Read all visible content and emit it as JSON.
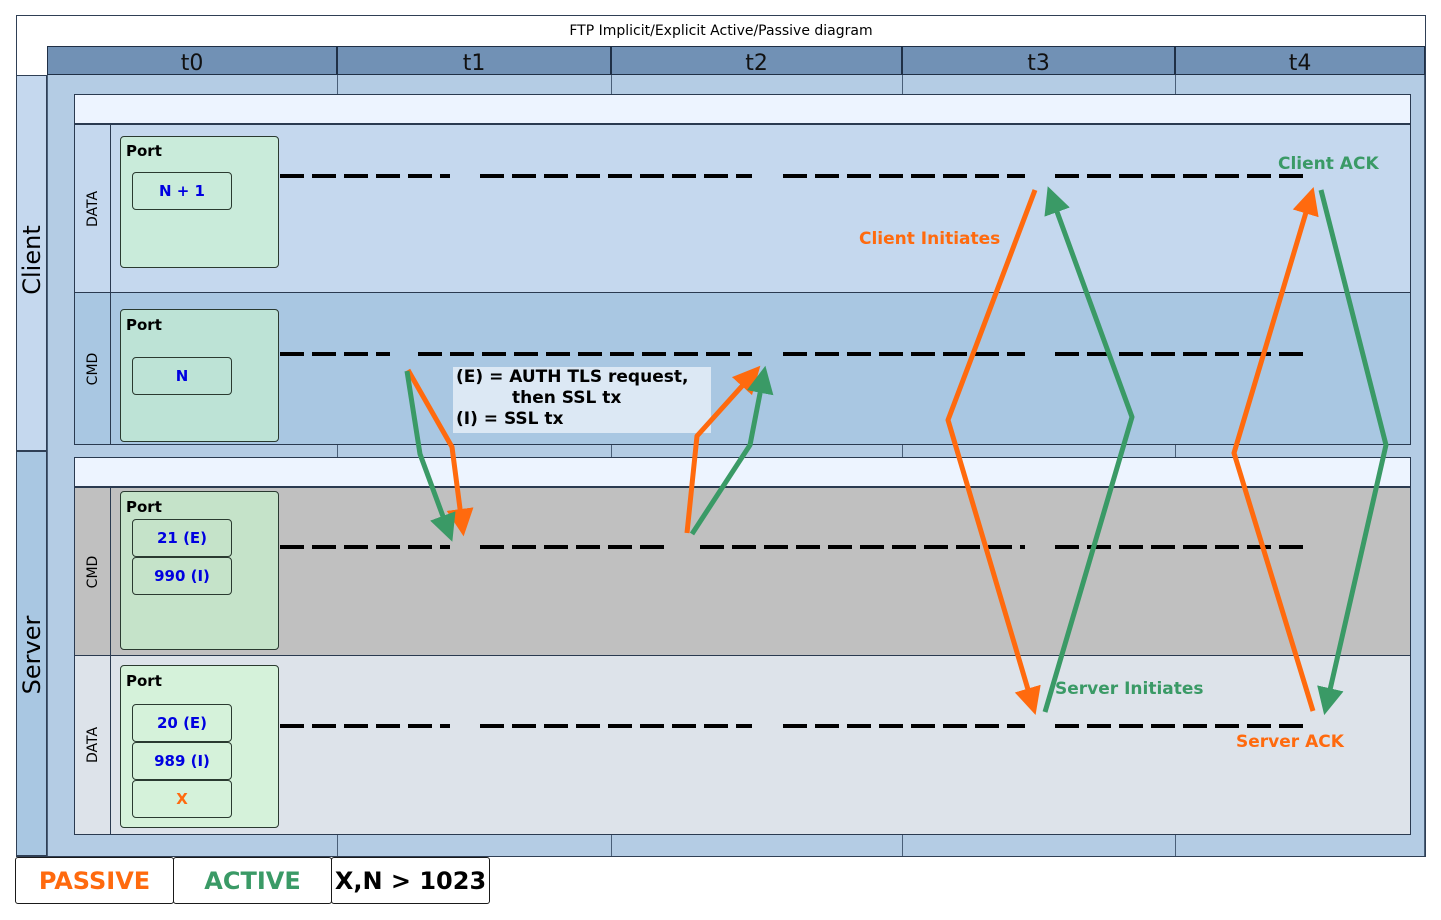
{
  "title": "FTP Implicit/Explicit Active/Passive diagram",
  "time_columns": [
    "t0",
    "t1",
    "t2",
    "t3",
    "t4"
  ],
  "pools": {
    "client": {
      "label": "Client",
      "lanes": {
        "data": {
          "label": "DATA",
          "port_title": "Port",
          "ports": [
            "N + 1"
          ]
        },
        "cmd": {
          "label": "CMD",
          "port_title": "Port",
          "ports": [
            "N"
          ]
        }
      }
    },
    "server": {
      "label": "Server",
      "lanes": {
        "cmd": {
          "label": "CMD",
          "port_title": "Port",
          "ports": [
            "21 (E)",
            "990 (I)"
          ]
        },
        "data": {
          "label": "DATA",
          "port_title": "Port",
          "ports": [
            "20 (E)",
            "989 (I)",
            "X"
          ]
        }
      }
    }
  },
  "note": {
    "line1": "(E) = AUTH TLS request,",
    "line2": "then SSL tx",
    "line3": "(I) = SSL tx"
  },
  "arrow_labels": {
    "client_initiates": "Client Initiates",
    "server_initiates": "Server Initiates",
    "client_ack": "Client ACK",
    "server_ack": "Server ACK"
  },
  "legend": {
    "passive": "PASSIVE",
    "active": "ACTIVE",
    "constraint": "X,N > 1023"
  },
  "colors": {
    "passive": "#ff6a0e",
    "active": "#3a9a66",
    "port_value_blue": "#0000e0",
    "header": "#7191b5",
    "client_lane_data": "#c5d8ee",
    "client_lane_cmd": "#a9c7e2",
    "server_lane_cmd": "#c0c0c0",
    "server_lane_data": "#dde3ea"
  }
}
